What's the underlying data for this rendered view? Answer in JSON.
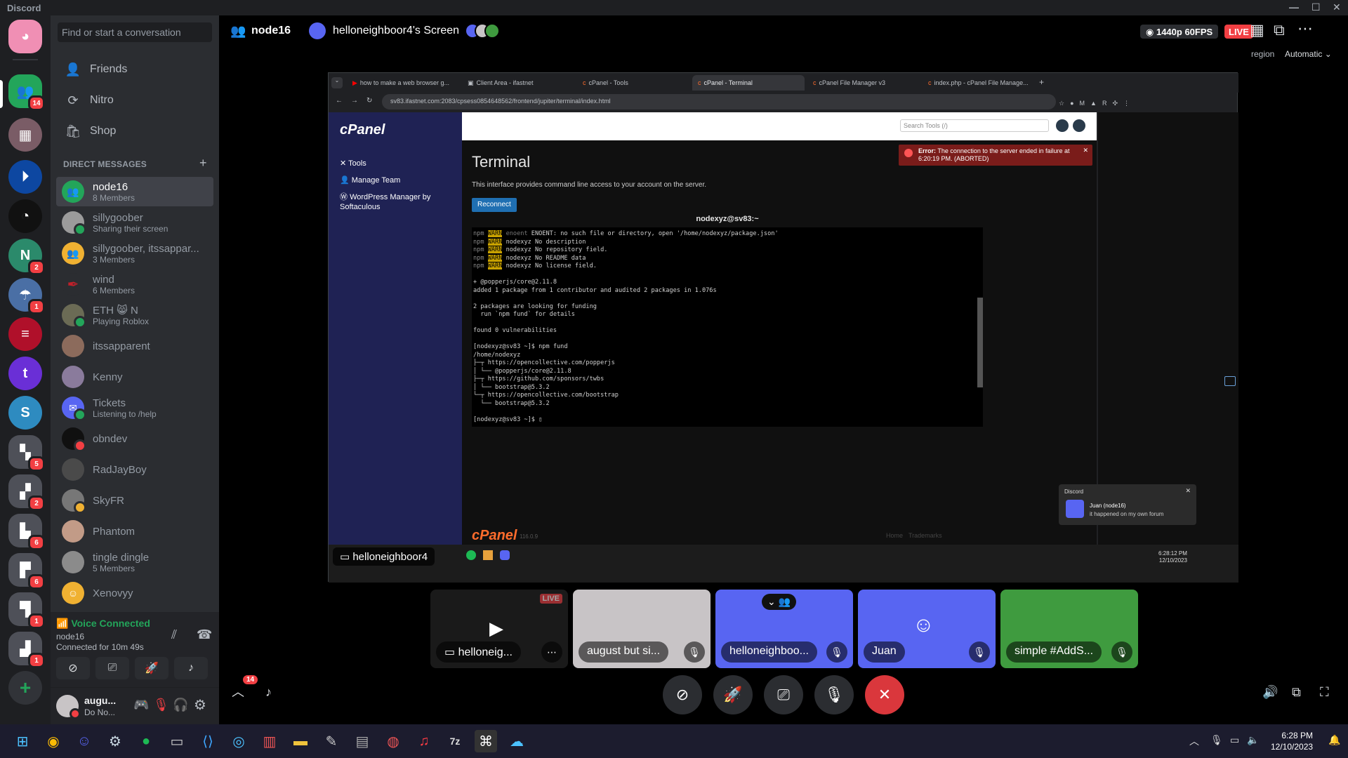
{
  "app": {
    "title": "Discord"
  },
  "search": {
    "placeholder": "Find or start a conversation"
  },
  "nav": [
    {
      "label": "Friends",
      "icon": "friends-icon"
    },
    {
      "label": "Nitro",
      "icon": "nitro-icon"
    },
    {
      "label": "Shop",
      "icon": "shop-icon"
    }
  ],
  "servers": {
    "home_badge": "14",
    "badges": [
      "2",
      "1",
      "5",
      "2",
      "6",
      "6",
      "1",
      "1"
    ]
  },
  "dm": {
    "header": "DIRECT MESSAGES",
    "items": [
      {
        "name": "node16",
        "sub": "8 Members",
        "color": "#23a55a"
      },
      {
        "name": "sillygoober",
        "sub": "Sharing their screen",
        "color": "#9b9b9b"
      },
      {
        "name": "sillygoober, itssappar...",
        "sub": "3 Members",
        "color": "#f0b132"
      },
      {
        "name": "wind",
        "sub": "6 Members",
        "color": "#c0202a"
      },
      {
        "name": "ETH 😸 N",
        "sub": "Playing Roblox",
        "color": "#6b6b55"
      },
      {
        "name": "itssapparent",
        "sub": "",
        "color": "#8c6b5c"
      },
      {
        "name": "Kenny",
        "sub": "",
        "color": "#8a7b9c"
      },
      {
        "name": "Tickets",
        "sub": "Listening to /help",
        "color": "#5865f2"
      },
      {
        "name": "obndev",
        "sub": "",
        "color": "#101010"
      },
      {
        "name": "RadJayBoy",
        "sub": "",
        "color": "#4a4a4a"
      },
      {
        "name": "SkyFR",
        "sub": "",
        "color": "#777"
      },
      {
        "name": "Phantom",
        "sub": "",
        "color": "#c29b87"
      },
      {
        "name": "tingle dingle",
        "sub": "5 Members",
        "color": "#8b8b8b"
      },
      {
        "name": "Xenovyy",
        "sub": "",
        "color": "#f0b132"
      }
    ]
  },
  "voice": {
    "status": "Voice Connected",
    "channel": "node16",
    "duration": "Connected for 10m 49s"
  },
  "user": {
    "name": "augu...",
    "status": "Do No..."
  },
  "header": {
    "channel": "node16",
    "stream_title": "helloneighboor4's Screen",
    "quality": "1440p 60FPS",
    "live": "LIVE",
    "region_label": "region",
    "region_value": "Automatic"
  },
  "browser": {
    "tabs": [
      "how to make a web browser g...",
      "Client Area - ifastnet",
      "cPanel - Tools",
      "cPanel - Terminal",
      "cPanel File Manager v3",
      "index.php - cPanel File Manage..."
    ],
    "url": "sv83.ifastnet.com:2083/cpsess0854648562/frontend/jupiter/terminal/index.html"
  },
  "cpanel": {
    "logo": "cPanel",
    "menu": [
      "Tools",
      "Manage Team",
      "WordPress Manager by Softaculous"
    ],
    "search_placeholder": "Search Tools (/)",
    "page_title": "Terminal",
    "description": "This interface provides command line access to your account on the server.",
    "reconnect": "Reconnect",
    "error_label": "Error:",
    "error_text": "The connection to the server ended in failure at 6:20:19 PM. (ABORTED)",
    "terminal_title": "nodexyz@sv83:~",
    "version": "116.0.9",
    "footer_links": [
      "Home",
      "Trademarks"
    ]
  },
  "terminal_lines": [
    {
      "pre": "npm",
      "tag": "WARN",
      "dim": "enoent",
      "text": " ENOENT: no such file or directory, open '/home/nodexyz/package.json'"
    },
    {
      "pre": "npm",
      "tag": "WARN",
      "dim": "",
      "text": " nodexyz No description"
    },
    {
      "pre": "npm",
      "tag": "WARN",
      "dim": "",
      "text": " nodexyz No repository field."
    },
    {
      "pre": "npm",
      "tag": "WARN",
      "dim": "",
      "text": " nodexyz No README data"
    },
    {
      "pre": "npm",
      "tag": "WARN",
      "dim": "",
      "text": " nodexyz No license field."
    },
    {
      "pre": "",
      "tag": "",
      "dim": "",
      "text": ""
    },
    {
      "pre": "",
      "tag": "",
      "dim": "",
      "text": "+ @popperjs/core@2.11.8"
    },
    {
      "pre": "",
      "tag": "",
      "dim": "",
      "text": "added 1 package from 1 contributor and audited 2 packages in 1.076s"
    },
    {
      "pre": "",
      "tag": "",
      "dim": "",
      "text": ""
    },
    {
      "pre": "",
      "tag": "",
      "dim": "",
      "text": "2 packages are looking for funding"
    },
    {
      "pre": "",
      "tag": "",
      "dim": "",
      "text": "  run `npm fund` for details"
    },
    {
      "pre": "",
      "tag": "",
      "dim": "",
      "text": ""
    },
    {
      "pre": "",
      "tag": "",
      "dim": "",
      "text": "found 0 vulnerabilities"
    },
    {
      "pre": "",
      "tag": "",
      "dim": "",
      "text": ""
    },
    {
      "pre": "",
      "tag": "",
      "dim": "",
      "text": "[nodexyz@sv83 ~]$ npm fund"
    },
    {
      "pre": "",
      "tag": "",
      "dim": "",
      "text": "/home/nodexyz"
    },
    {
      "pre": "",
      "tag": "",
      "dim": "",
      "text": "├─┬ https://opencollective.com/popperjs"
    },
    {
      "pre": "",
      "tag": "",
      "dim": "",
      "text": "│ └── @popperjs/core@2.11.8"
    },
    {
      "pre": "",
      "tag": "",
      "dim": "",
      "text": "├─┬ https://github.com/sponsors/twbs"
    },
    {
      "pre": "",
      "tag": "",
      "dim": "",
      "text": "│ └── bootstrap@5.3.2"
    },
    {
      "pre": "",
      "tag": "",
      "dim": "",
      "text": "└─┬ https://opencollective.com/bootstrap"
    },
    {
      "pre": "",
      "tag": "",
      "dim": "",
      "text": "  └── bootstrap@5.3.2"
    },
    {
      "pre": "",
      "tag": "",
      "dim": "",
      "text": ""
    },
    {
      "pre": "",
      "tag": "",
      "dim": "",
      "text": "[nodexyz@sv83 ~]$ ▯"
    }
  ],
  "toast": {
    "app": "Discord",
    "title": "Juan (node16)",
    "message": "it happened on my own forum"
  },
  "inner_taskbar": {
    "stream_label": "helloneighboor4",
    "time": "6:28:12 PM",
    "date": "12/10/2023"
  },
  "tiles": [
    {
      "label": "helloneig...",
      "live": "LIVE",
      "bg": "#1a1a1a"
    },
    {
      "label": "august but si...",
      "bg": "#c8c4c6"
    },
    {
      "label": "helloneighboo...",
      "bg": "#5865f2"
    },
    {
      "label": "Juan",
      "bg": "#5865f2"
    },
    {
      "label": "simple #AddS...",
      "bg": "#3f9b3f"
    }
  ],
  "controls": {
    "badge": "14"
  },
  "taskbar": {
    "time": "6:28 PM",
    "date": "12/10/2023"
  }
}
